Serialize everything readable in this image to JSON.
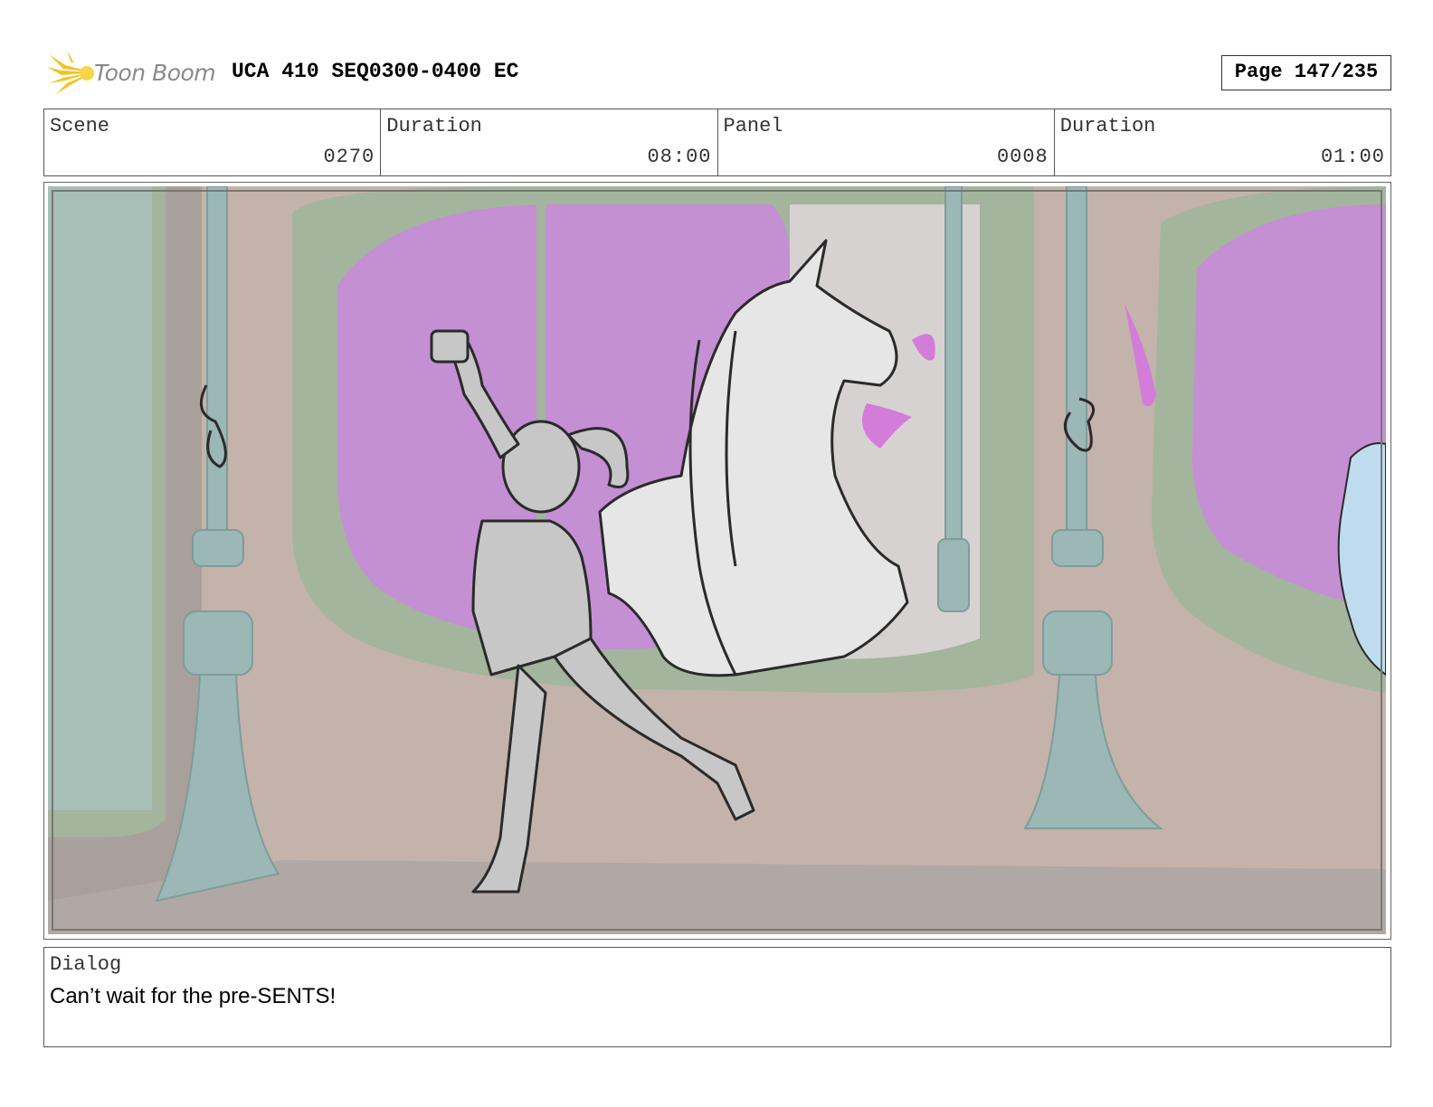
{
  "header": {
    "logo_text": "Toon Boom",
    "doc_title": "UCA 410 SEQ0300-0400 EC",
    "page_label": "Page 147/235"
  },
  "info": {
    "scene_label": "Scene",
    "scene_value": "0270",
    "scene_duration_label": "Duration",
    "scene_duration_value": "08:00",
    "panel_label": "Panel",
    "panel_value": "0008",
    "panel_duration_label": "Duration",
    "panel_duration_value": "01:00"
  },
  "dialog": {
    "label": "Dialog",
    "text": "Can’t wait for the pre-SENTS!"
  },
  "colors": {
    "logo_accent": "#f6c21a",
    "window_glass": "#c48fd3",
    "wall": "#c3b3aa",
    "pillar": "#9bb7b6",
    "window_frame": "#a3b59d"
  },
  "icons": {
    "logo": "toon-boom-burst-icon"
  }
}
